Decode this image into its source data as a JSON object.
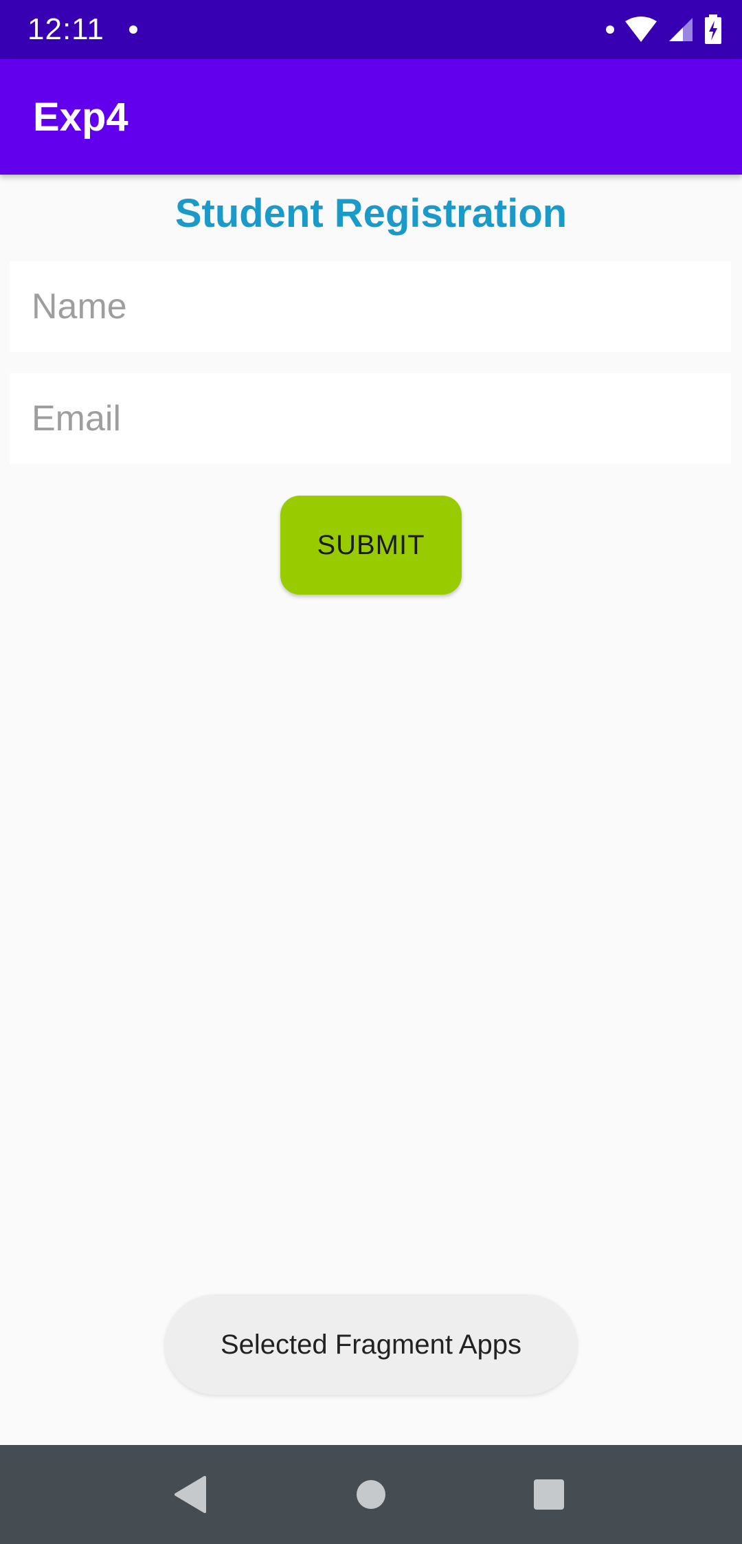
{
  "status_bar": {
    "time": "12:11",
    "icons": [
      "notification-dot-icon",
      "wifi-icon",
      "cell-signal-icon",
      "battery-charging-icon"
    ]
  },
  "app_bar": {
    "title": "Exp4",
    "background": "#6200ee"
  },
  "form": {
    "title": "Student Registration",
    "title_color": "#1a9ac9",
    "name_placeholder": "Name",
    "name_value": "",
    "email_placeholder": "Email",
    "email_value": "",
    "submit_label": "SUBMIT",
    "submit_color": "#99cc00"
  },
  "toast": {
    "message": "Selected Fragment Apps"
  },
  "nav_bar": {
    "buttons": [
      "back-icon",
      "home-icon",
      "recents-icon"
    ]
  }
}
